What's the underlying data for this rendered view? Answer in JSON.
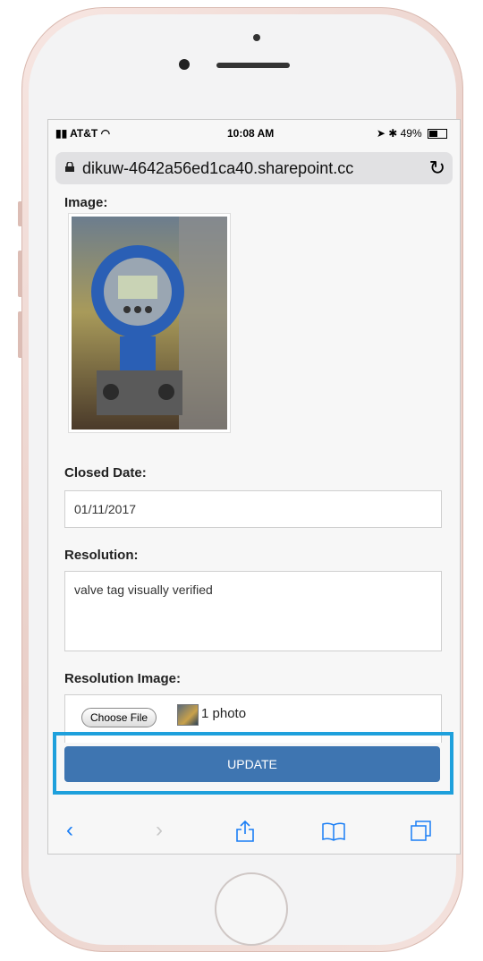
{
  "status_bar": {
    "carrier": "AT&T",
    "time": "10:08 AM",
    "battery": "49%"
  },
  "browser": {
    "url": "dikuw-4642a56ed1ca40.sharepoint.cc"
  },
  "form": {
    "image_label": "Image:",
    "closed_date_label": "Closed Date:",
    "closed_date_value": "01/11/2017",
    "resolution_label": "Resolution:",
    "resolution_value": "valve tag visually verified",
    "resolution_image_label": "Resolution Image:",
    "choose_file_label": "Choose File",
    "file_count": "1 photo",
    "update_label": "UPDATE"
  },
  "colors": {
    "accent": "#3e75b1",
    "highlight": "#1ea0dc",
    "toolbar_icon": "#1a7ef5"
  },
  "toolbar": {
    "icons": [
      "back-icon",
      "forward-icon",
      "share-icon",
      "bookmarks-icon",
      "tabs-icon"
    ]
  }
}
